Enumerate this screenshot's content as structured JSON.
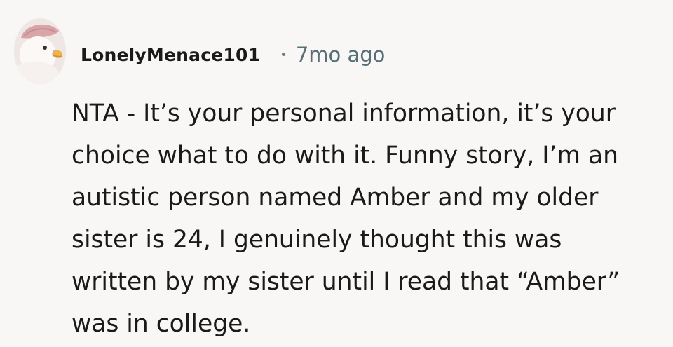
{
  "comment": {
    "author": "LonelyMenace101",
    "separator": "•",
    "timestamp": "7mo ago",
    "avatar_icon": "duck-avatar-icon",
    "body_lines": [
      "NTA - It’s your personal information, it’s your",
      "choice what to do with it. Funny story, I’m an",
      "autistic person named Amber and my older",
      "sister is 24, I genuinely thought this was",
      "written by my sister until I read that “Amber”",
      "was in college."
    ]
  },
  "colors": {
    "background": "#f8f7f6",
    "text": "#1a1a1b",
    "meta_text": "#576f76"
  }
}
